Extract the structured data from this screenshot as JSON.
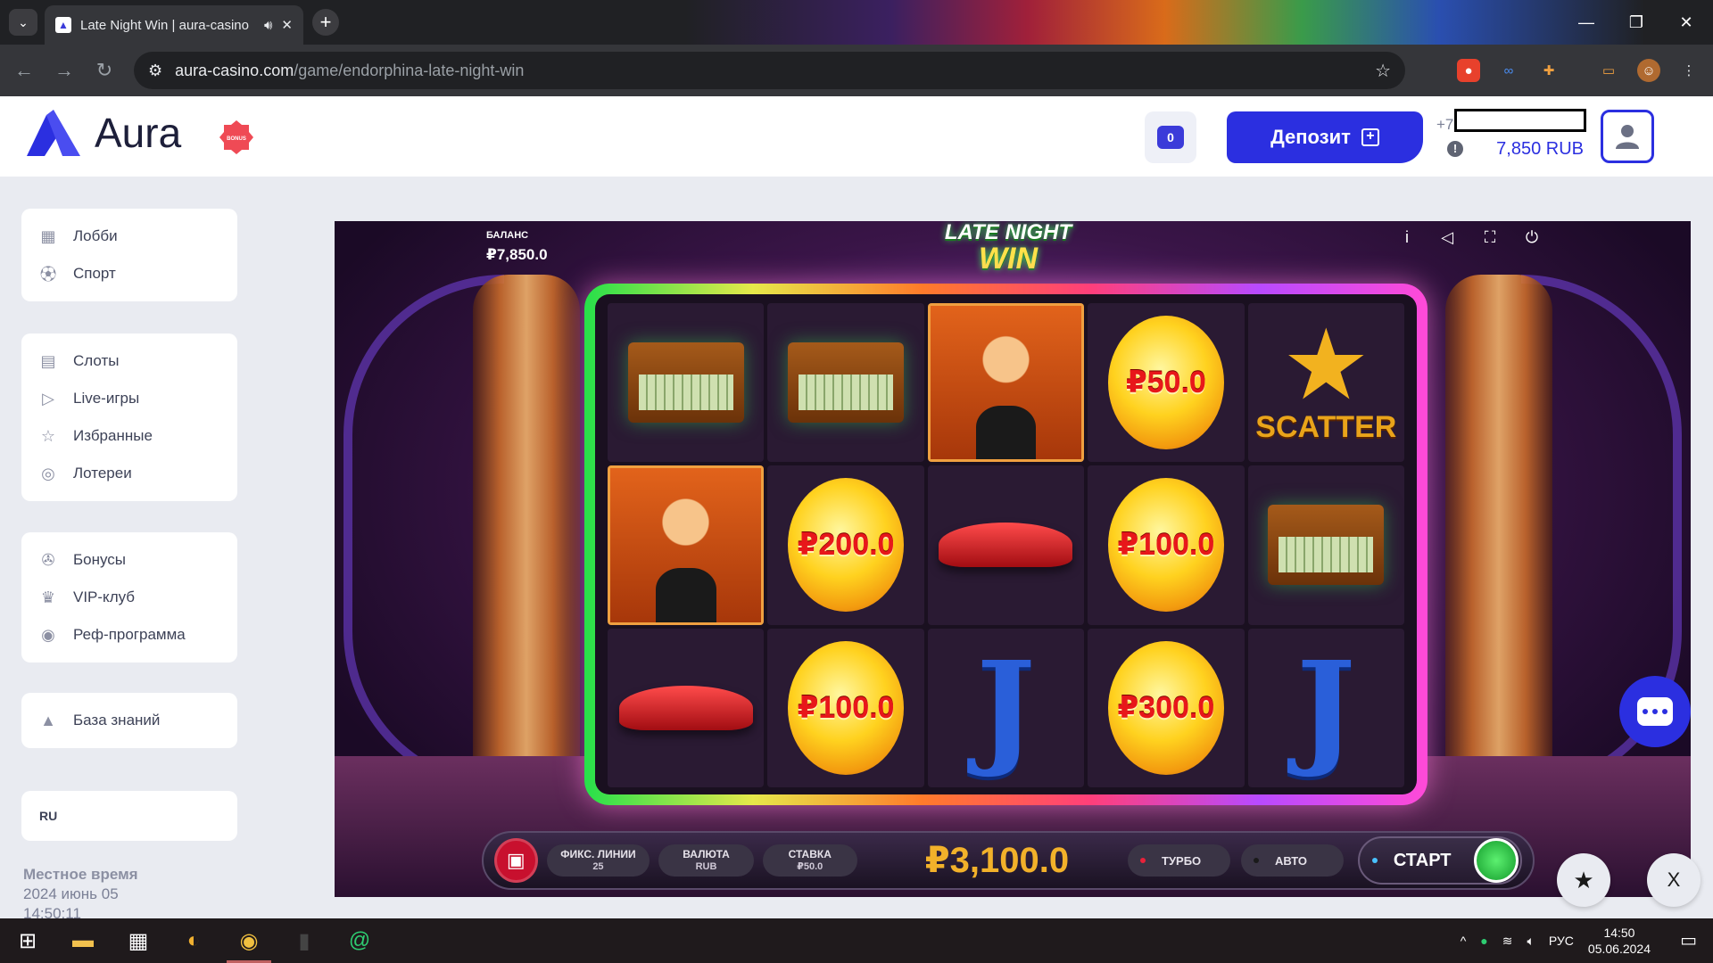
{
  "browser": {
    "tab_title": "Late Night Win | aura-casino",
    "url_host": "aura-casino.com",
    "url_path": "/game/endorphina-late-night-win"
  },
  "site": {
    "logo_text": "Aura",
    "bonus_badge": "BONUS",
    "notifications_count": "0",
    "deposit_label": "Депозит",
    "phone_prefix": "+7",
    "balance": "7,850 RUB",
    "accent_color": "#2b2fe0"
  },
  "sidebar": {
    "group1": [
      {
        "label": "Лобби",
        "icon": "lobby-icon"
      },
      {
        "label": "Спорт",
        "icon": "sport-icon"
      }
    ],
    "group2": [
      {
        "label": "Слоты",
        "icon": "slots-icon"
      },
      {
        "label": "Live-игры",
        "icon": "play-icon"
      },
      {
        "label": "Избранные",
        "icon": "star-icon"
      },
      {
        "label": "Лотереи",
        "icon": "lottery-icon"
      }
    ],
    "group3": [
      {
        "label": "Бонусы",
        "icon": "gift-icon"
      },
      {
        "label": "VIP-клуб",
        "icon": "crown-icon"
      },
      {
        "label": "Реф-программа",
        "icon": "referral-icon"
      }
    ],
    "group4": [
      {
        "label": "База знаний",
        "icon": "knowledge-icon"
      }
    ],
    "language": "RU",
    "local_time_label": "Местное время",
    "local_date": "2024 июнь 05",
    "local_time": "14:50:11"
  },
  "game": {
    "title_line1": "LATE NIGHT",
    "title_line2": "WIN",
    "balance_label": "БАЛАНС",
    "balance_value": "₽7,850.0",
    "reels": [
      [
        "case",
        "man",
        "car"
      ],
      [
        "case",
        "₽200.0",
        "₽100.0"
      ],
      [
        "man",
        "car",
        "J"
      ],
      [
        "₽50.0",
        "₽100.0",
        "₽300.0"
      ],
      [
        "SCATTER",
        "case",
        "J"
      ]
    ],
    "lines_label": "ФИКС. ЛИНИИ",
    "lines_value": "25",
    "currency_label": "ВАЛЮТА",
    "currency_value": "RUB",
    "bet_label": "СТАВКА",
    "bet_value": "₽50.0",
    "total": "₽3,100.0",
    "turbo_label": "ТУРБО",
    "auto_label": "АВТО",
    "start_label": "СТАРТ"
  },
  "floating": {
    "close_label": "X"
  },
  "taskbar": {
    "lang": "РУС",
    "time": "14:50",
    "date": "05.06.2024"
  }
}
